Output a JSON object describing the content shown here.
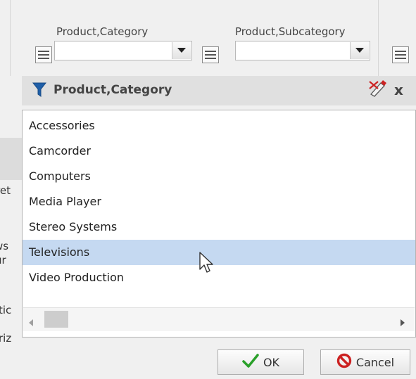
{
  "filters": [
    {
      "label": "Product,Category",
      "value": ""
    },
    {
      "label": "Product,Subcategory",
      "value": ""
    }
  ],
  "left_cutoff": [
    "ret",
    "ws",
    "ur",
    "tic",
    "riz"
  ],
  "dialog": {
    "title": "Product,Category",
    "close_label": "x",
    "items": [
      "Accessories",
      "Camcorder",
      "Computers",
      "Media Player",
      "Stereo Systems",
      "Televisions",
      "Video Production"
    ],
    "selected_item": "Televisions",
    "ok_label": "OK",
    "cancel_label": "Cancel"
  },
  "colors": {
    "selection": "#c5d9f1",
    "filter_icon": "#1f5fa8",
    "ok_check": "#2aa02a",
    "cancel_icon": "#cc2222"
  }
}
